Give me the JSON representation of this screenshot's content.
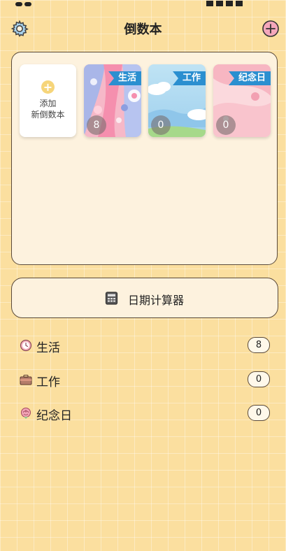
{
  "header": {
    "title": "倒数本"
  },
  "add_card": {
    "label_line1": "添加",
    "label_line2": "新倒数本"
  },
  "books": [
    {
      "name": "生活",
      "count": "8"
    },
    {
      "name": "工作",
      "count": "0"
    },
    {
      "name": "纪念日",
      "count": "0"
    }
  ],
  "calculator": {
    "label": "日期计算器"
  },
  "categories": [
    {
      "label": "生活",
      "count": "8",
      "icon": "clock-icon"
    },
    {
      "label": "工作",
      "count": "0",
      "icon": "briefcase-icon"
    },
    {
      "label": "纪念日",
      "count": "0",
      "icon": "rose-icon"
    }
  ],
  "colors": {
    "background": "#fbdf9f",
    "panel": "#fdf2de",
    "tag_blue": "#2b8fd0",
    "accent_pink": "#e9638a"
  }
}
